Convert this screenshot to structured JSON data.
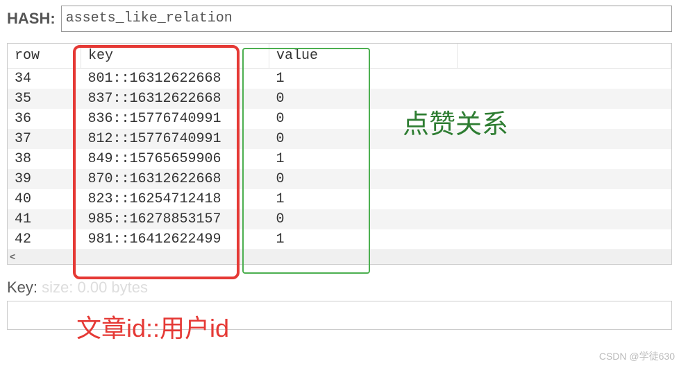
{
  "hash": {
    "label": "HASH:",
    "value": "assets_like_relation"
  },
  "columns": {
    "row": "row",
    "key": "key",
    "value": "value"
  },
  "rows": [
    {
      "row": "34",
      "key": "801::16312622668",
      "value": "1"
    },
    {
      "row": "35",
      "key": "837::16312622668",
      "value": "0"
    },
    {
      "row": "36",
      "key": "836::15776740991",
      "value": "0"
    },
    {
      "row": "37",
      "key": "812::15776740991",
      "value": "0"
    },
    {
      "row": "38",
      "key": "849::15765659906",
      "value": "1"
    },
    {
      "row": "39",
      "key": "870::16312622668",
      "value": "0"
    },
    {
      "row": "40",
      "key": "823::16254712418",
      "value": "1"
    },
    {
      "row": "41",
      "key": "985::16278853157",
      "value": "0"
    },
    {
      "row": "42",
      "key": "981::16412622499",
      "value": "1"
    }
  ],
  "key_section": {
    "label": "Key:",
    "faded": " size: 0.00 bytes"
  },
  "annotations": {
    "like_relation": "点赞关系",
    "id_format": "文章id::用户id"
  },
  "watermark": "CSDN @学徒630",
  "scroll_arrow": "<"
}
